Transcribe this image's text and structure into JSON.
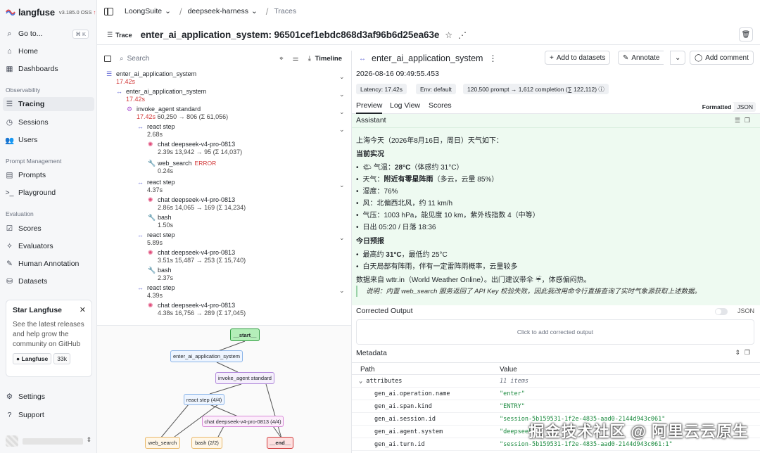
{
  "brand": {
    "name": "langfuse",
    "version": "v3.185.0 OSS",
    "version_mark": "↑"
  },
  "nav": {
    "goto": {
      "label": "Go to...",
      "shortcut": "⌘ K"
    },
    "home": "Home",
    "dashboards": "Dashboards",
    "observability_section": "Observability",
    "tracing": "Tracing",
    "sessions": "Sessions",
    "users": "Users",
    "prompt_section": "Prompt Management",
    "prompts": "Prompts",
    "playground": "Playground",
    "evaluation_section": "Evaluation",
    "scores": "Scores",
    "evaluators": "Evaluators",
    "human_annotation": "Human Annotation",
    "datasets": "Datasets",
    "settings": "Settings",
    "support": "Support"
  },
  "star_card": {
    "title": "Star Langfuse",
    "description": "See the latest releases and help grow the community on GitHub",
    "button": "Langfuse",
    "count": "33k"
  },
  "breadcrumb": {
    "org": "LoongSuite",
    "project": "deepseek-harness",
    "page": "Traces"
  },
  "trace": {
    "tag": "Trace",
    "title": "enter_ai_application_system: 96501cef1ebdc868d3af96b6d25ea63e"
  },
  "tree_toolbar": {
    "search_placeholder": "Search",
    "timeline": "Timeline"
  },
  "tree": [
    {
      "name": "enter_ai_application_system",
      "latency": "17.42s",
      "meta": ""
    },
    {
      "name": "enter_ai_application_system",
      "latency": "17.42s",
      "meta": ""
    },
    {
      "name": "invoke_agent standard",
      "latency": "17.42s",
      "meta": "60,250 → 806 (Σ 61,056)"
    },
    {
      "name": "react step",
      "latency": "2.68s",
      "meta": ""
    },
    {
      "name": "chat deepseek-v4-pro-0813",
      "latency": "2.39s",
      "meta": "13,942 → 95 (Σ 14,037)"
    },
    {
      "name": "web_search",
      "latency": "0.24s",
      "meta": "",
      "status": "ERROR"
    },
    {
      "name": "react step",
      "latency": "4.37s",
      "meta": ""
    },
    {
      "name": "chat deepseek-v4-pro-0813",
      "latency": "2.86s",
      "meta": "14,065 → 169 (Σ 14,234)"
    },
    {
      "name": "bash",
      "latency": "1.50s",
      "meta": ""
    },
    {
      "name": "react step",
      "latency": "5.89s",
      "meta": ""
    },
    {
      "name": "chat deepseek-v4-pro-0813",
      "latency": "3.51s",
      "meta": "15,487 → 253 (Σ 15,740)"
    },
    {
      "name": "bash",
      "latency": "2.37s",
      "meta": ""
    },
    {
      "name": "react step",
      "latency": "4.39s",
      "meta": ""
    },
    {
      "name": "chat deepseek-v4-pro-0813",
      "latency": "4.38s",
      "meta": "16,756 → 289 (Σ 17,045)"
    }
  ],
  "graph": {
    "start": "__start__",
    "app": "enter_ai_application_system",
    "agent": "invoke_agent standard",
    "react": "react step (4/4)",
    "chat": "chat deepseek-v4-pro-0813 (4/4)",
    "web": "web_search",
    "bash": "bash (2/2)",
    "end": "__end__"
  },
  "detail": {
    "name": "enter_ai_application_system",
    "add_to_datasets": "Add to datasets",
    "annotate": "Annotate",
    "add_comment": "Add comment",
    "timestamp": "2026-08-16 09:49:55.453",
    "latency": "Latency: 17.42s",
    "env": "Env: default",
    "tokens": "120,500 prompt → 1,612 completion (∑ 122,112)",
    "tabs": {
      "preview": "Preview",
      "log_view": "Log View",
      "scores": "Scores"
    },
    "format": {
      "formatted": "Formatted",
      "json": "JSON"
    }
  },
  "assistant": {
    "label": "Assistant",
    "intro": "上海今天（2026年8月16日，周日）天气如下：",
    "current_heading": "当前实况",
    "current": [
      {
        "pre": "🌤 气温：",
        "bold": "28°C",
        "post": "（体感约 31°C）"
      },
      {
        "pre": "天气：",
        "bold": "附近有零星阵雨",
        "post": "（多云，云量 85%）"
      },
      {
        "pre": "湿度：76%",
        "bold": "",
        "post": ""
      },
      {
        "pre": "风：北偏西北风，约 11 km/h",
        "bold": "",
        "post": ""
      },
      {
        "pre": "气压：1003 hPa，能见度 10 km，紫外线指数 4（中等）",
        "bold": "",
        "post": ""
      },
      {
        "pre": "日出 05:20 / 日落 18:36",
        "bold": "",
        "post": ""
      }
    ],
    "forecast_heading": "今日预报",
    "forecast": [
      {
        "pre": "最高约 ",
        "bold": "31°C",
        "post": "，最低约 25°C"
      },
      {
        "pre": "白天局部有阵雨，伴有一定雷阵雨概率，云量较多",
        "bold": "",
        "post": ""
      }
    ],
    "source": "数据来自 wttr.in（World Weather Online）。出门建议带伞 ☔，体感偏闷热。",
    "note": "说明：内置 web_search 服务返回了 API Key 校验失败，因此我改用命令行直接查询了实时气象源获取上述数据。"
  },
  "corrected": {
    "label": "Corrected Output",
    "json": "JSON",
    "placeholder": "Click to add corrected output"
  },
  "metadata": {
    "label": "Metadata",
    "col_path": "Path",
    "col_value": "Value",
    "rows": [
      {
        "key": "attributes",
        "value": "11 items",
        "indent": 0,
        "italic": true
      },
      {
        "key": "gen_ai.operation.name",
        "value": "\"enter\"",
        "indent": 1
      },
      {
        "key": "gen_ai.span.kind",
        "value": "\"ENTRY\"",
        "indent": 1
      },
      {
        "key": "gen_ai.session.id",
        "value": "\"session-5b159531-1f2e-4835-aad0-2144d943c061\"",
        "indent": 1
      },
      {
        "key": "gen_ai.agent.system",
        "value": "\"deepseek\"",
        "indent": 1
      },
      {
        "key": "gen_ai.turn.id",
        "value": "\"session-5b159531-1f2e-4835-aad0-2144d943c061:1\"",
        "indent": 1
      }
    ]
  },
  "watermark": "掘金技术社区 @ 阿里云云原生"
}
